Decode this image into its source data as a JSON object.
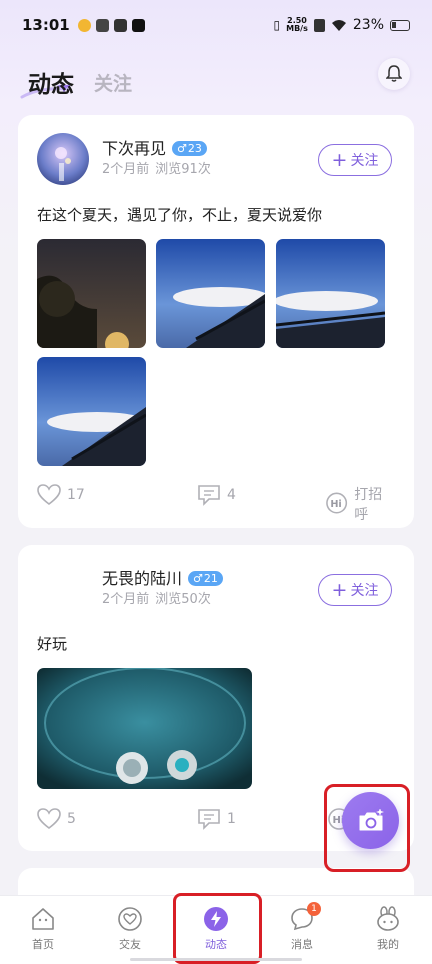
{
  "status_bar": {
    "time": "13:01",
    "network_speed_value": "2.50",
    "network_speed_unit": "MB/s",
    "battery": "23%"
  },
  "header": {
    "active_tab": "动态",
    "inactive_tab": "关注"
  },
  "posts": [
    {
      "username": "下次再见",
      "gender_symbol": "♂",
      "age": "23",
      "time_ago": "2个月前",
      "views": "浏览91次",
      "follow_label": "关注",
      "text": "在这个夏天，遇见了你，不止，夏天说爱你",
      "likes": "17",
      "comments": "4",
      "greet_label": "打招呼"
    },
    {
      "username": "无畏的陆川",
      "gender_symbol": "♂",
      "age": "21",
      "time_ago": "2个月前",
      "views": "浏览50次",
      "follow_label": "关注",
      "text": "好玩",
      "likes": "5",
      "comments": "1",
      "greet_label": ""
    }
  ],
  "tabbar": {
    "items": [
      {
        "label": "首页",
        "icon": "home-icon"
      },
      {
        "label": "交友",
        "icon": "heart-icon"
      },
      {
        "label": "动态",
        "icon": "lightning-icon"
      },
      {
        "label": "消息",
        "icon": "chat-icon",
        "badge": "1"
      },
      {
        "label": "我的",
        "icon": "bunny-icon"
      }
    ]
  },
  "colors": {
    "accent": "#8b63e8",
    "highlight_box": "#d81f26",
    "badge_blue": "#5aa6f5"
  }
}
